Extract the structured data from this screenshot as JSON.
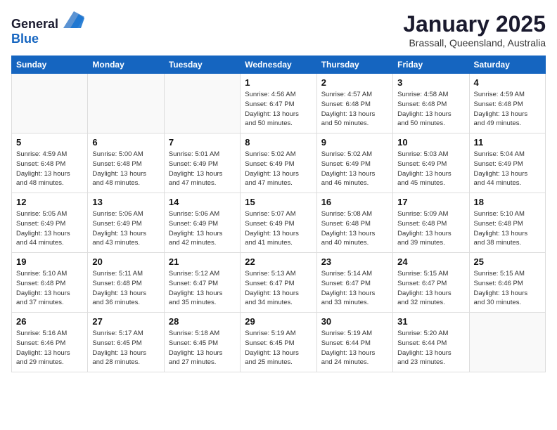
{
  "header": {
    "logo_general": "General",
    "logo_blue": "Blue",
    "month_title": "January 2025",
    "subtitle": "Brassall, Queensland, Australia"
  },
  "days_of_week": [
    "Sunday",
    "Monday",
    "Tuesday",
    "Wednesday",
    "Thursday",
    "Friday",
    "Saturday"
  ],
  "weeks": [
    [
      {
        "day": "",
        "info": ""
      },
      {
        "day": "",
        "info": ""
      },
      {
        "day": "",
        "info": ""
      },
      {
        "day": "1",
        "info": "Sunrise: 4:56 AM\nSunset: 6:47 PM\nDaylight: 13 hours\nand 50 minutes."
      },
      {
        "day": "2",
        "info": "Sunrise: 4:57 AM\nSunset: 6:48 PM\nDaylight: 13 hours\nand 50 minutes."
      },
      {
        "day": "3",
        "info": "Sunrise: 4:58 AM\nSunset: 6:48 PM\nDaylight: 13 hours\nand 50 minutes."
      },
      {
        "day": "4",
        "info": "Sunrise: 4:59 AM\nSunset: 6:48 PM\nDaylight: 13 hours\nand 49 minutes."
      }
    ],
    [
      {
        "day": "5",
        "info": "Sunrise: 4:59 AM\nSunset: 6:48 PM\nDaylight: 13 hours\nand 48 minutes."
      },
      {
        "day": "6",
        "info": "Sunrise: 5:00 AM\nSunset: 6:48 PM\nDaylight: 13 hours\nand 48 minutes."
      },
      {
        "day": "7",
        "info": "Sunrise: 5:01 AM\nSunset: 6:49 PM\nDaylight: 13 hours\nand 47 minutes."
      },
      {
        "day": "8",
        "info": "Sunrise: 5:02 AM\nSunset: 6:49 PM\nDaylight: 13 hours\nand 47 minutes."
      },
      {
        "day": "9",
        "info": "Sunrise: 5:02 AM\nSunset: 6:49 PM\nDaylight: 13 hours\nand 46 minutes."
      },
      {
        "day": "10",
        "info": "Sunrise: 5:03 AM\nSunset: 6:49 PM\nDaylight: 13 hours\nand 45 minutes."
      },
      {
        "day": "11",
        "info": "Sunrise: 5:04 AM\nSunset: 6:49 PM\nDaylight: 13 hours\nand 44 minutes."
      }
    ],
    [
      {
        "day": "12",
        "info": "Sunrise: 5:05 AM\nSunset: 6:49 PM\nDaylight: 13 hours\nand 44 minutes."
      },
      {
        "day": "13",
        "info": "Sunrise: 5:06 AM\nSunset: 6:49 PM\nDaylight: 13 hours\nand 43 minutes."
      },
      {
        "day": "14",
        "info": "Sunrise: 5:06 AM\nSunset: 6:49 PM\nDaylight: 13 hours\nand 42 minutes."
      },
      {
        "day": "15",
        "info": "Sunrise: 5:07 AM\nSunset: 6:49 PM\nDaylight: 13 hours\nand 41 minutes."
      },
      {
        "day": "16",
        "info": "Sunrise: 5:08 AM\nSunset: 6:48 PM\nDaylight: 13 hours\nand 40 minutes."
      },
      {
        "day": "17",
        "info": "Sunrise: 5:09 AM\nSunset: 6:48 PM\nDaylight: 13 hours\nand 39 minutes."
      },
      {
        "day": "18",
        "info": "Sunrise: 5:10 AM\nSunset: 6:48 PM\nDaylight: 13 hours\nand 38 minutes."
      }
    ],
    [
      {
        "day": "19",
        "info": "Sunrise: 5:10 AM\nSunset: 6:48 PM\nDaylight: 13 hours\nand 37 minutes."
      },
      {
        "day": "20",
        "info": "Sunrise: 5:11 AM\nSunset: 6:48 PM\nDaylight: 13 hours\nand 36 minutes."
      },
      {
        "day": "21",
        "info": "Sunrise: 5:12 AM\nSunset: 6:47 PM\nDaylight: 13 hours\nand 35 minutes."
      },
      {
        "day": "22",
        "info": "Sunrise: 5:13 AM\nSunset: 6:47 PM\nDaylight: 13 hours\nand 34 minutes."
      },
      {
        "day": "23",
        "info": "Sunrise: 5:14 AM\nSunset: 6:47 PM\nDaylight: 13 hours\nand 33 minutes."
      },
      {
        "day": "24",
        "info": "Sunrise: 5:15 AM\nSunset: 6:47 PM\nDaylight: 13 hours\nand 32 minutes."
      },
      {
        "day": "25",
        "info": "Sunrise: 5:15 AM\nSunset: 6:46 PM\nDaylight: 13 hours\nand 30 minutes."
      }
    ],
    [
      {
        "day": "26",
        "info": "Sunrise: 5:16 AM\nSunset: 6:46 PM\nDaylight: 13 hours\nand 29 minutes."
      },
      {
        "day": "27",
        "info": "Sunrise: 5:17 AM\nSunset: 6:45 PM\nDaylight: 13 hours\nand 28 minutes."
      },
      {
        "day": "28",
        "info": "Sunrise: 5:18 AM\nSunset: 6:45 PM\nDaylight: 13 hours\nand 27 minutes."
      },
      {
        "day": "29",
        "info": "Sunrise: 5:19 AM\nSunset: 6:45 PM\nDaylight: 13 hours\nand 25 minutes."
      },
      {
        "day": "30",
        "info": "Sunrise: 5:19 AM\nSunset: 6:44 PM\nDaylight: 13 hours\nand 24 minutes."
      },
      {
        "day": "31",
        "info": "Sunrise: 5:20 AM\nSunset: 6:44 PM\nDaylight: 13 hours\nand 23 minutes."
      },
      {
        "day": "",
        "info": ""
      }
    ]
  ]
}
